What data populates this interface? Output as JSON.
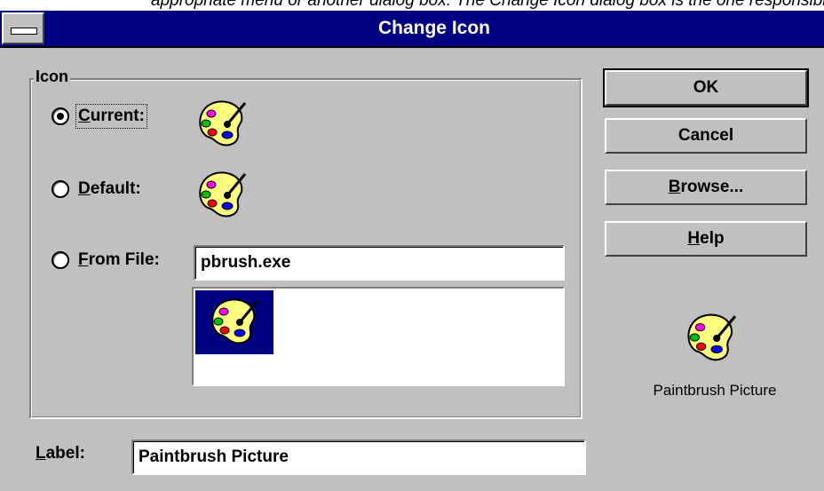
{
  "caption": "appropriate menu or another dialog box: The Change Icon dialog box is the one responsible for this particular",
  "window": {
    "title": "Change Icon"
  },
  "icon_group": {
    "label": "Icon",
    "options": [
      {
        "label": "Current:",
        "mnemonic": "C",
        "rest": "urrent:",
        "checked": true
      },
      {
        "label": "Default:",
        "mnemonic": "D",
        "rest": "efault:",
        "checked": false
      },
      {
        "label": "From File:",
        "mnemonic": "F",
        "rest": "rom File:",
        "checked": false
      }
    ],
    "from_file_value": "pbrush.exe"
  },
  "buttons": {
    "ok": "OK",
    "cancel": "Cancel",
    "browse_mnemonic": "B",
    "browse_rest": "rowse...",
    "help_mnemonic": "H",
    "help_rest": "elp"
  },
  "preview_caption": "Paintbrush Picture",
  "label_field": {
    "mnemonic": "L",
    "rest": "abel:",
    "value": "Paintbrush Picture"
  },
  "icons": {
    "palette": "paint-palette-icon"
  }
}
